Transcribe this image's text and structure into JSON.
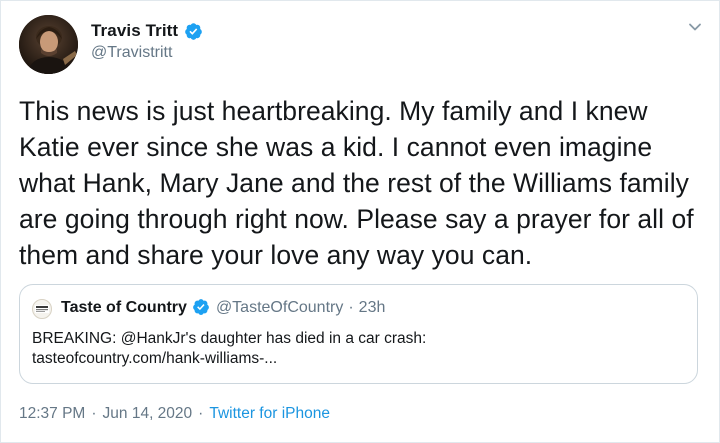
{
  "author": {
    "display_name": "Travis Tritt",
    "handle": "@Travistritt",
    "verified_icon": "verified-badge-icon"
  },
  "tweet": {
    "text": "This news is just heartbreaking. My family and I knew Katie ever since she was a kid. I cannot even imagine what Hank, Mary Jane and the rest of the Williams family are going through right now. Please say a prayer for all of them and share your love any way you can."
  },
  "quoted_tweet": {
    "display_name": "Taste of Country",
    "handle": "@TasteOfCountry",
    "separator": "·",
    "age": "23h",
    "text_lines": [
      "BREAKING: @HankJr's daughter has died in a car crash:",
      "tasteofcountry.com/hank-williams-..."
    ],
    "avatar_text": "TASTE OF COUNTRY"
  },
  "meta": {
    "time": "12:37 PM",
    "separator": "·",
    "date": "Jun 14, 2020",
    "separator2": "·",
    "source": "Twitter for iPhone"
  },
  "colors": {
    "verified_blue": "#1da1f2",
    "link_blue": "#1b95e0",
    "secondary_text": "#657786",
    "border": "#e1e8ed"
  }
}
